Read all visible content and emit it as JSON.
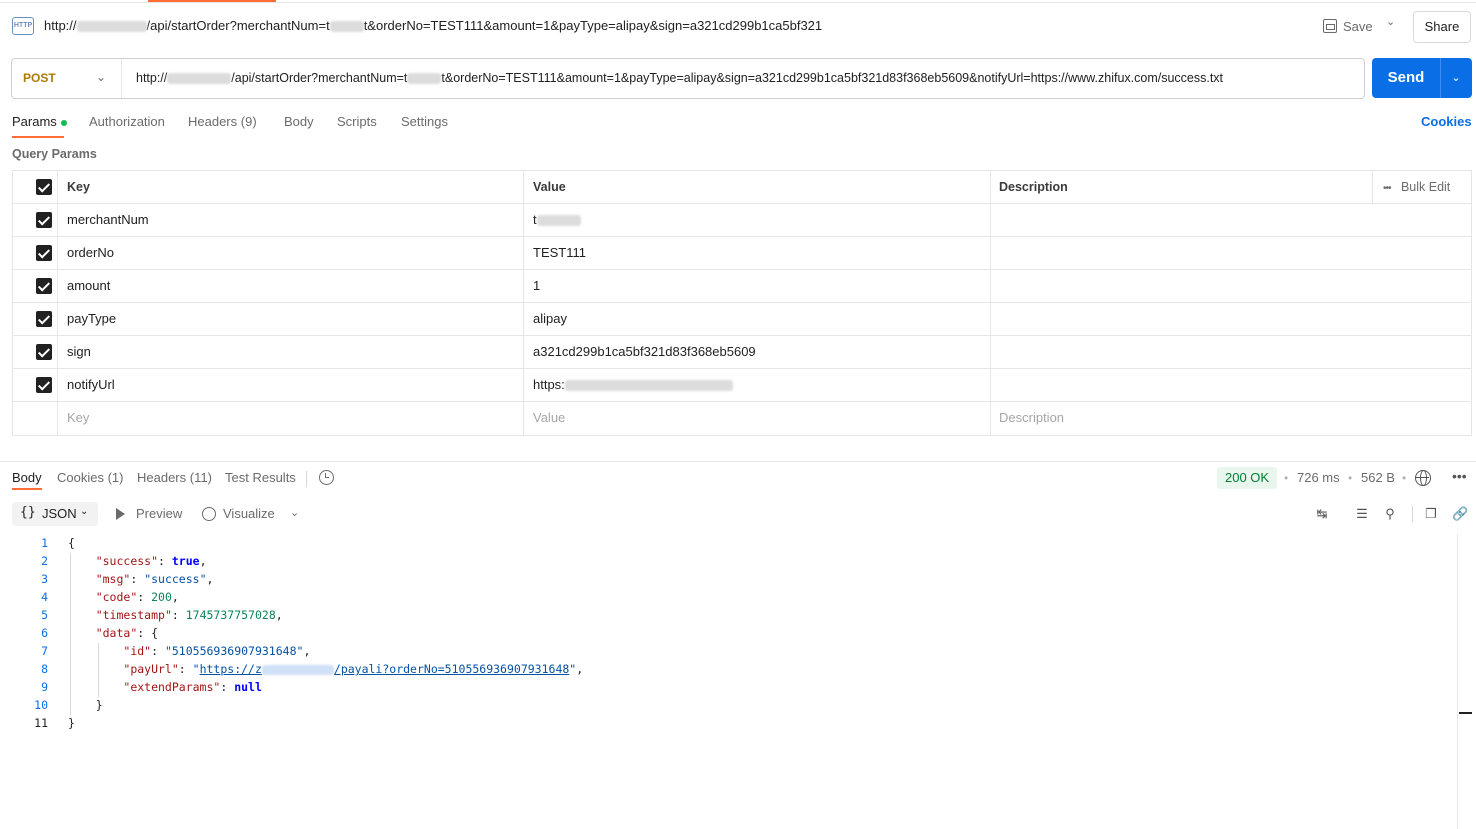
{
  "title": {
    "prefix": "http://",
    "part1": "/api/startOrder?merchantNum=t",
    "part2": "t&orderNo=TEST111&amount=1&payType=alipay&sign=a321cd299b1ca5bf321",
    "icon_label": "HTTP"
  },
  "header": {
    "save_label": "Save",
    "share_label": "Share"
  },
  "request": {
    "method": "POST",
    "url_prefix": "http://",
    "url_part1": "/api/startOrder?merchantNum=t",
    "url_part2": "t&orderNo=TEST111&amount=1&payType=alipay&sign=a321cd299b1ca5bf321d83f368eb5609&notifyUrl=https://www.zhifux.com/success.txt",
    "send_label": "Send"
  },
  "request_tabs": [
    {
      "label": "Params"
    },
    {
      "label": "Authorization"
    },
    {
      "label": "Headers",
      "count": "(9)"
    },
    {
      "label": "Body"
    },
    {
      "label": "Scripts"
    },
    {
      "label": "Settings"
    }
  ],
  "cookies_link": "Cookies",
  "query_params": {
    "label": "Query Params",
    "columns": {
      "key": "Key",
      "value": "Value",
      "description": "Description"
    },
    "bulk_edit": "Bulk Edit",
    "rows": [
      {
        "key": "merchantNum",
        "value": "t"
      },
      {
        "key": "orderNo",
        "value": "TEST111"
      },
      {
        "key": "amount",
        "value": "1"
      },
      {
        "key": "payType",
        "value": "alipay"
      },
      {
        "key": "sign",
        "value": "a321cd299b1ca5bf321d83f368eb5609"
      },
      {
        "key": "notifyUrl",
        "value": "https:"
      }
    ],
    "placeholder": {
      "key": "Key",
      "value": "Value",
      "description": "Description"
    }
  },
  "response_tabs": [
    {
      "label": "Body"
    },
    {
      "label": "Cookies",
      "count": "(1)"
    },
    {
      "label": "Headers",
      "count": "(11)"
    },
    {
      "label": "Test Results"
    }
  ],
  "response_meta": {
    "status": "200 OK",
    "time": "726 ms",
    "size": "562 B"
  },
  "response_toolbar": {
    "format": "JSON",
    "preview": "Preview",
    "visualize": "Visualize"
  },
  "code": {
    "success_key": "\"success\"",
    "success_val": "true",
    "msg_key": "\"msg\"",
    "msg_val": "\"success\"",
    "code_key": "\"code\"",
    "code_val": "200",
    "timestamp_key": "\"timestamp\"",
    "timestamp_val": "1745737757028",
    "data_key": "\"data\"",
    "id_key": "\"id\"",
    "id_val": "\"510556936907931648\"",
    "payurl_key": "\"payUrl\"",
    "payurl_pre": "https://z",
    "payurl_post": "/payali?orderNo=510556936907931648",
    "extend_key": "\"extendParams\"",
    "extend_val": "null"
  },
  "colors": {
    "accent": "#ff6c37",
    "send": "#0a6fe6",
    "method": "#ad7a03",
    "status_ok": "#007f31"
  }
}
